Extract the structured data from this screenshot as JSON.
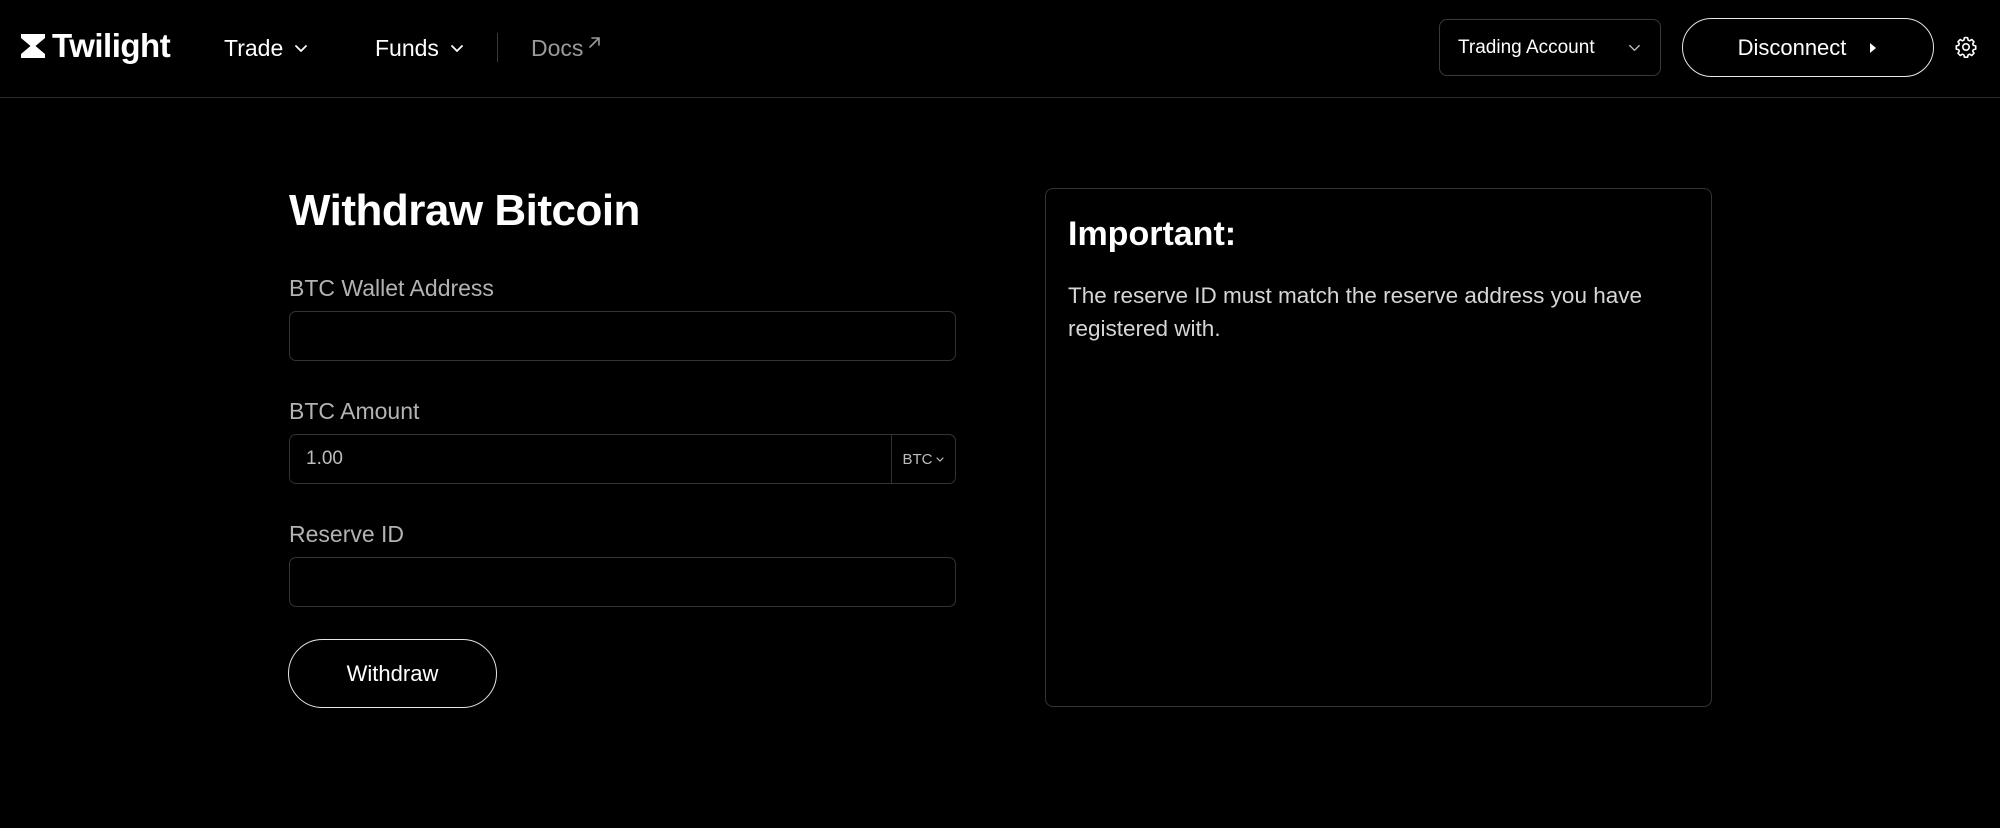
{
  "header": {
    "logo_text": "Twilight",
    "nav": {
      "trade": "Trade",
      "funds": "Funds",
      "docs": "Docs"
    },
    "account_select": "Trading Account",
    "disconnect_label": "Disconnect"
  },
  "form": {
    "title": "Withdraw Bitcoin",
    "wallet_label": "BTC Wallet Address",
    "wallet_value": "",
    "amount_label": "BTC Amount",
    "amount_value": "1.00",
    "amount_unit": "BTC",
    "reserve_label": "Reserve ID",
    "reserve_value": "",
    "submit_label": "Withdraw"
  },
  "info": {
    "title": "Important:",
    "text": "The reserve ID must match the reserve address you have registered with."
  },
  "icons": {
    "logo": "twilight-hourglass-icon",
    "trade_chevron": "chevron-down-icon",
    "funds_chevron": "chevron-down-icon",
    "docs_external": "external-link-icon",
    "account_chevron": "chevron-down-icon",
    "disconnect_arrow": "caret-right-icon",
    "settings": "gear-icon",
    "unit_chevron": "chevron-down-icon"
  }
}
